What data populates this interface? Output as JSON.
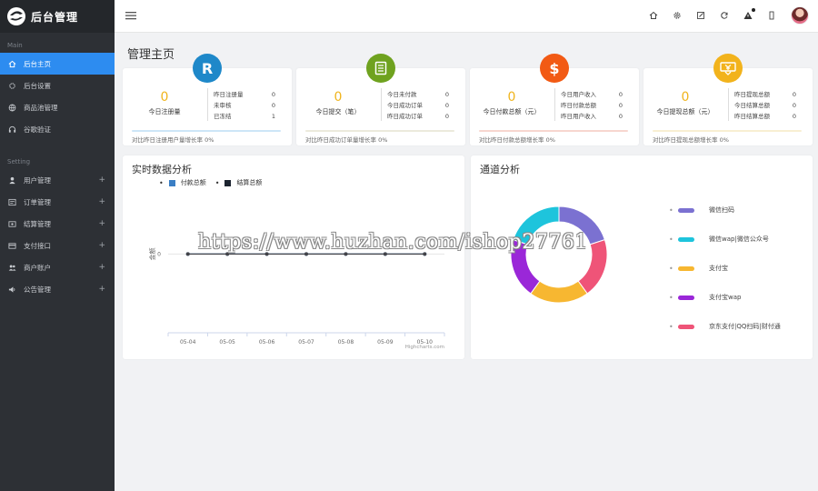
{
  "brand": {
    "title": "后台管理"
  },
  "sidebar": {
    "sections": [
      {
        "title": "Main",
        "items": [
          {
            "label": "后台主页",
            "icon": "home-icon",
            "active": true,
            "expandable": false
          },
          {
            "label": "后台设置",
            "icon": "gear-icon",
            "active": false,
            "expandable": false
          },
          {
            "label": "商品池管理",
            "icon": "globe-icon",
            "active": false,
            "expandable": false
          },
          {
            "label": "谷歌验证",
            "icon": "headset-icon",
            "active": false,
            "expandable": false
          }
        ]
      },
      {
        "title": "Setting",
        "items": [
          {
            "label": "用户管理",
            "icon": "user-icon",
            "active": false,
            "expandable": true
          },
          {
            "label": "订单管理",
            "icon": "order-icon",
            "active": false,
            "expandable": true
          },
          {
            "label": "结算管理",
            "icon": "settle-icon",
            "active": false,
            "expandable": true
          },
          {
            "label": "支付接口",
            "icon": "card-icon",
            "active": false,
            "expandable": true
          },
          {
            "label": "商户账户",
            "icon": "users-icon",
            "active": false,
            "expandable": true
          },
          {
            "label": "公告管理",
            "icon": "speaker-icon",
            "active": false,
            "expandable": true
          }
        ]
      }
    ],
    "plus": "+"
  },
  "page": {
    "title": "管理主页"
  },
  "stats": [
    {
      "badge": "R",
      "badge_color": "#1e88c9",
      "value": "0",
      "label": "今日注册量",
      "rows": [
        {
          "k": "昨日注册量",
          "v": "0"
        },
        {
          "k": "未审核",
          "v": "0"
        },
        {
          "k": "已冻结",
          "v": "1"
        }
      ],
      "bar_color": "#cde6f7",
      "footer": "对比昨日注册用户量增长率 0%"
    },
    {
      "badge": "",
      "badge_color": "#6fa21f",
      "value": "0",
      "label": "今日提交（笔）",
      "rows": [
        {
          "k": "今日未付款",
          "v": "0"
        },
        {
          "k": "今日成功订单",
          "v": "0"
        },
        {
          "k": "昨日成功订单",
          "v": "0"
        }
      ],
      "bar_color": "#eceadc",
      "footer": "对比昨日成功订单量增长率 0%"
    },
    {
      "badge": "$",
      "badge_color": "#f25a14",
      "value": "0",
      "label": "今日付款总额（元）",
      "rows": [
        {
          "k": "今日用户收入",
          "v": "0"
        },
        {
          "k": "昨日付款总额",
          "v": "0"
        },
        {
          "k": "昨日用户收入",
          "v": "0"
        }
      ],
      "bar_color": "#f7d6cf",
      "footer": "对比昨日付款总额增长率 0%"
    },
    {
      "badge": "",
      "badge_color": "#f2b31c",
      "value": "0",
      "label": "今日提现总额（元）",
      "rows": [
        {
          "k": "昨日提现总额",
          "v": "0"
        },
        {
          "k": "今日结算总额",
          "v": "0"
        },
        {
          "k": "昨日结算总额",
          "v": "0"
        }
      ],
      "bar_color": "#f8efd2",
      "footer": "对比昨日提现总额增长率 0%"
    }
  ],
  "realtime": {
    "title": "实时数据分析",
    "legend": [
      {
        "name": "付款总额",
        "color": "#3a7ec4"
      },
      {
        "name": "结算总额",
        "color": "#1c2430"
      }
    ],
    "credits": "Highcharts.com",
    "y_title": "金额"
  },
  "chart_data": [
    {
      "type": "line",
      "title": "实时数据分析",
      "x": [
        "05-04",
        "05-05",
        "05-06",
        "05-07",
        "05-08",
        "05-09",
        "05-10"
      ],
      "series": [
        {
          "name": "付款总额",
          "values": [
            0,
            0,
            0,
            0,
            0,
            0,
            0
          ],
          "color": "#3a7ec4"
        },
        {
          "name": "结算总额",
          "values": [
            0,
            0,
            0,
            0,
            0,
            0,
            0
          ],
          "color": "#434348"
        }
      ],
      "y_ticks": [
        "0"
      ],
      "ylim": [
        -1,
        1
      ]
    },
    {
      "type": "pie",
      "title": "通道分析",
      "categories": [
        "微信扫码",
        "微信wap|微信公众号",
        "支付宝",
        "支付宝wap",
        "京东支付|QQ扫码|财付通"
      ],
      "values": [
        1,
        1,
        1,
        1,
        1
      ],
      "colors": [
        "#7b71d1",
        "#1ec4dc",
        "#f7b731",
        "#9a27d8",
        "#ef5478"
      ]
    }
  ],
  "channel": {
    "title": "通道分析",
    "items": [
      {
        "label": "微信扫码",
        "color": "#7b71d1"
      },
      {
        "label": "微信wap|微信公众号",
        "color": "#1ec4dc"
      },
      {
        "label": "支付宝",
        "color": "#f7b731"
      },
      {
        "label": "支付宝wap",
        "color": "#9a27d8"
      },
      {
        "label": "京东支付|QQ扫码|财付通",
        "color": "#ef5478"
      }
    ]
  },
  "watermark": "https://www.huzhan.com/ishop27761"
}
